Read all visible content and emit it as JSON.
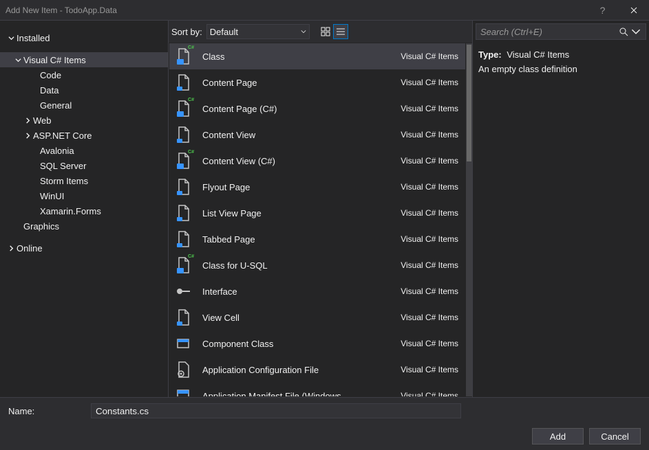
{
  "window": {
    "title": "Add New Item - TodoApp.Data"
  },
  "tree": {
    "root": "Installed",
    "selected": "Visual C# Items",
    "items": [
      {
        "label": "Code"
      },
      {
        "label": "Data"
      },
      {
        "label": "General"
      },
      {
        "label": "Web",
        "expandable": true
      },
      {
        "label": "ASP.NET Core",
        "expandable": true
      },
      {
        "label": "Avalonia"
      },
      {
        "label": "SQL Server"
      },
      {
        "label": "Storm Items"
      },
      {
        "label": "WinUI"
      },
      {
        "label": "Xamarin.Forms"
      }
    ],
    "graphics": "Graphics",
    "online": "Online"
  },
  "sort": {
    "label": "Sort by:",
    "value": "Default"
  },
  "templates": {
    "category": "Visual C# Items",
    "items": [
      {
        "name": "Class",
        "selected": true,
        "icon": "class"
      },
      {
        "name": "Content Page",
        "icon": "page"
      },
      {
        "name": "Content Page (C#)",
        "icon": "class"
      },
      {
        "name": "Content View",
        "icon": "page"
      },
      {
        "name": "Content View (C#)",
        "icon": "class"
      },
      {
        "name": "Flyout Page",
        "icon": "page"
      },
      {
        "name": "List View Page",
        "icon": "page"
      },
      {
        "name": "Tabbed Page",
        "icon": "page"
      },
      {
        "name": "Class for U-SQL",
        "icon": "class"
      },
      {
        "name": "Interface",
        "icon": "interface"
      },
      {
        "name": "View Cell",
        "icon": "page"
      },
      {
        "name": "Component Class",
        "icon": "component"
      },
      {
        "name": "Application Configuration File",
        "icon": "config"
      },
      {
        "name": "Application Manifest File (Windows",
        "icon": "manifest"
      }
    ]
  },
  "search": {
    "placeholder": "Search (Ctrl+E)"
  },
  "details": {
    "typeLabel": "Type:",
    "typeValue": "Visual C# Items",
    "description": "An empty class definition"
  },
  "footer": {
    "nameLabel": "Name:",
    "nameValue": "Constants.cs",
    "addLabel": "Add",
    "cancelLabel": "Cancel"
  }
}
